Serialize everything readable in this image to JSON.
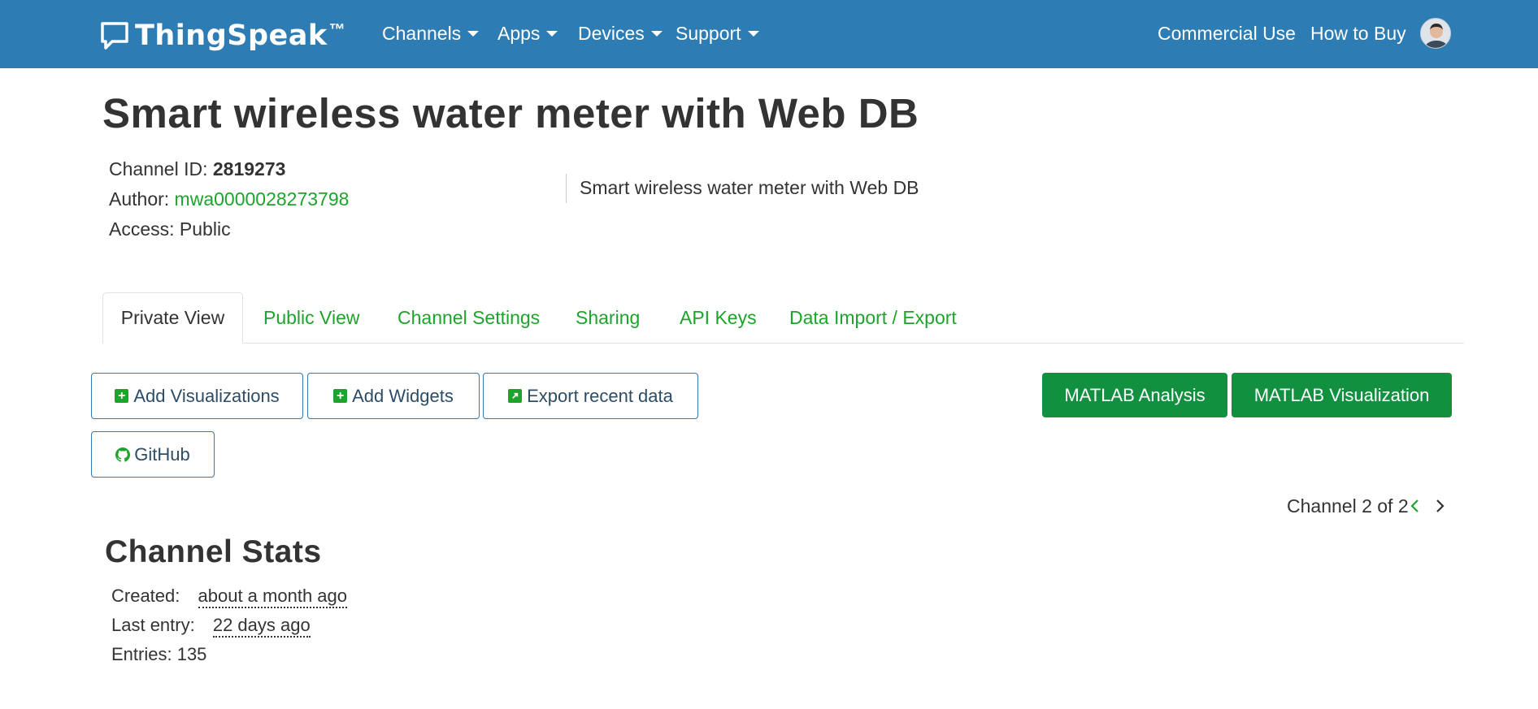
{
  "navbar": {
    "brand": "ThingSpeak",
    "brand_tm": "™",
    "menus": [
      {
        "label": "Channels"
      },
      {
        "label": "Apps"
      },
      {
        "label": "Devices"
      },
      {
        "label": "Support"
      }
    ],
    "right_links": [
      "Commercial Use",
      "How to Buy"
    ]
  },
  "channel": {
    "title": "Smart wireless water meter with Web DB",
    "id_label": "Channel ID: ",
    "id_value": "2819273",
    "author_label": "Author: ",
    "author_value": "mwa0000028273798",
    "access_label": "Access: ",
    "access_value": "Public",
    "description": "Smart wireless water meter with Web DB"
  },
  "tabs": [
    {
      "label": "Private View",
      "active": true
    },
    {
      "label": "Public View"
    },
    {
      "label": "Channel Settings"
    },
    {
      "label": "Sharing"
    },
    {
      "label": "API Keys"
    },
    {
      "label": "Data Import / Export"
    }
  ],
  "actions": {
    "add_visualizations": "Add Visualizations",
    "add_widgets": "Add Widgets",
    "export_recent": "Export recent data",
    "github": "GitHub",
    "matlab_analysis": "MATLAB Analysis",
    "matlab_visualization": "MATLAB Visualization"
  },
  "channel_nav": {
    "text": "Channel 2 of 2"
  },
  "stats": {
    "title": "Channel Stats",
    "created_label": "Created:",
    "created_value": "about a month ago",
    "last_entry_label": "Last entry:",
    "last_entry_value": "22 days ago",
    "entries_label": "Entries: ",
    "entries_value": "135"
  },
  "colors": {
    "navbar": "#2e7cb4",
    "link_green": "#1ea32c",
    "button_green": "#119140"
  },
  "icons": [
    "thingspeak-logo-icon",
    "caret-down-icon",
    "user-avatar-icon",
    "plus-square-icon",
    "external-link-icon",
    "github-icon",
    "chevron-left-icon",
    "chevron-right-icon"
  ]
}
